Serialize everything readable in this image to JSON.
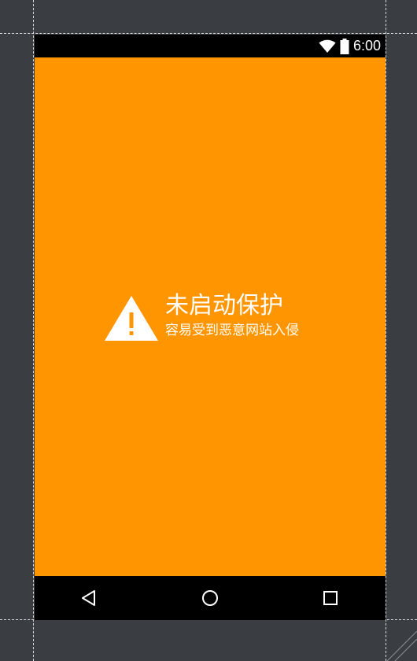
{
  "status_bar": {
    "time": "6:00",
    "icons": [
      "wifi-icon",
      "battery-icon"
    ]
  },
  "warning": {
    "icon": "warning-triangle-icon",
    "title": "未启动保护",
    "subtitle": "容易受到恶意网站入侵"
  },
  "nav_bar": {
    "buttons": [
      "back-icon",
      "home-icon",
      "recents-icon"
    ]
  },
  "colors": {
    "background": "#ff9500",
    "text": "#ffffff",
    "bars": "#000000",
    "frame": "#3a3d41"
  }
}
